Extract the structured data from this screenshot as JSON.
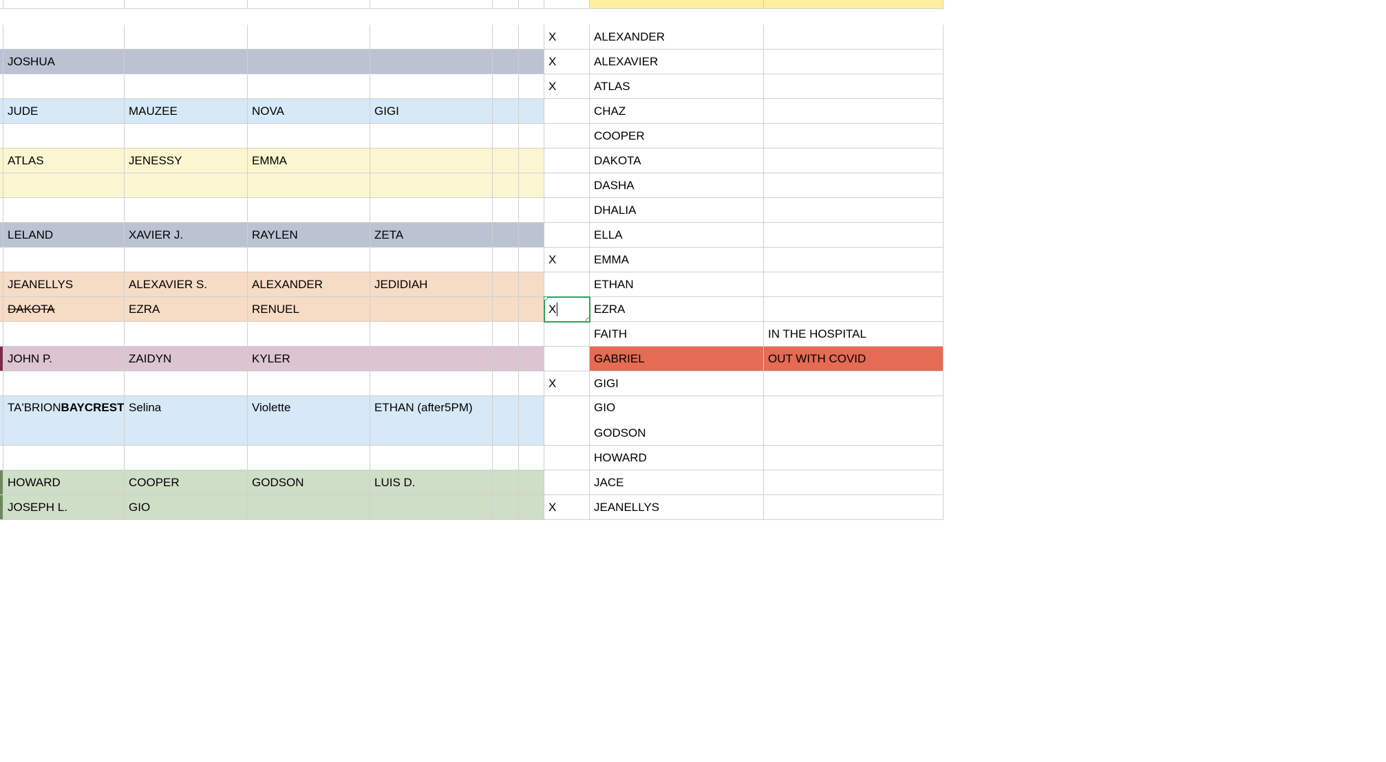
{
  "colors": {
    "yellow": "#ffef9e",
    "bluegray": "#bbc3d2",
    "ltblue": "#d7e8f6",
    "cream": "#fbf6d0",
    "peach": "#f6dbc5",
    "mauve": "#dcc4d1",
    "green": "#cfdec7",
    "red": "#e56b54"
  },
  "active_cell": {
    "row": 12,
    "col": "H",
    "value": "X"
  },
  "left_rows": [
    {
      "fill": null,
      "cells": [
        "",
        "",
        "",
        "",
        "",
        ""
      ]
    },
    {
      "fill": "bluegray",
      "cells": [
        "JOSHUA",
        "",
        "",
        "",
        "",
        ""
      ]
    },
    {
      "fill": null,
      "cells": [
        "",
        "",
        "",
        "",
        "",
        ""
      ]
    },
    {
      "fill": "ltblue",
      "cells": [
        "JUDE",
        "MAUZEE",
        "NOVA",
        "GIGI",
        "",
        ""
      ]
    },
    {
      "fill": null,
      "cells": [
        "",
        "",
        "",
        "",
        "",
        ""
      ]
    },
    {
      "fill": "cream",
      "cells": [
        "ATLAS",
        "JENESSY",
        "EMMA",
        "",
        "",
        ""
      ]
    },
    {
      "fill": "cream",
      "cells": [
        "",
        "",
        "",
        "",
        "",
        ""
      ]
    },
    {
      "fill": null,
      "cells": [
        "",
        "",
        "",
        "",
        "",
        ""
      ]
    },
    {
      "fill": "bluegray",
      "cells": [
        "LELAND",
        "XAVIER J.",
        "RAYLEN",
        "ZETA",
        "",
        ""
      ]
    },
    {
      "fill": null,
      "cells": [
        "",
        "",
        "",
        "",
        "",
        ""
      ]
    },
    {
      "fill": "peach",
      "cells": [
        "JEANELLYS",
        "ALEXAVIER S.",
        "ALEXANDER",
        "JEDIDIAH",
        "",
        ""
      ]
    },
    {
      "fill": "peach",
      "cells": [
        "DAKOTA",
        "EZRA",
        "RENUEL",
        "",
        "",
        ""
      ],
      "strike_first": true
    },
    {
      "fill": null,
      "cells": [
        "",
        "",
        "",
        "",
        "",
        ""
      ]
    },
    {
      "fill": "mauve",
      "cells": [
        "JOHN P.",
        "ZAIDYN",
        "KYLER",
        "",
        "",
        ""
      ],
      "left_edge": "mauve"
    },
    {
      "fill": null,
      "cells": [
        "",
        "",
        "",
        "",
        "",
        ""
      ]
    },
    {
      "fill": "ltblue",
      "two_line": true,
      "cells_lines": [
        [
          "TA'BRION",
          "BAYCREST"
        ],
        [
          "Selina"
        ],
        [
          "Violette"
        ],
        [
          "ETHAN (after",
          "5PM)"
        ],
        [
          ""
        ],
        [
          ""
        ]
      ]
    },
    {
      "fill": "ltblue",
      "cells": [
        "",
        "",
        "",
        "",
        "",
        ""
      ]
    },
    {
      "fill": null,
      "cells": [
        "",
        "",
        "",
        "",
        "",
        ""
      ]
    },
    {
      "fill": "green",
      "cells": [
        "HOWARD",
        "COOPER",
        "GODSON",
        "LUIS D.",
        "",
        ""
      ],
      "left_edge": "green"
    },
    {
      "fill": "green",
      "cells": [
        "JOSEPH L.",
        "GIO",
        "",
        "",
        "",
        ""
      ],
      "left_edge": "green"
    }
  ],
  "right_header_fill": "yellow",
  "right_rows": [
    {
      "H": "X",
      "I": "ALEXANDER",
      "J": ""
    },
    {
      "H": "X",
      "I": "ALEXAVIER",
      "J": ""
    },
    {
      "H": "X",
      "I": "ATLAS",
      "J": ""
    },
    {
      "H": "",
      "I": "CHAZ",
      "J": ""
    },
    {
      "H": "",
      "I": "COOPER",
      "J": ""
    },
    {
      "H": "",
      "I": "DAKOTA",
      "J": ""
    },
    {
      "H": "",
      "I": "DASHA",
      "J": ""
    },
    {
      "H": "",
      "I": "DHALIA",
      "J": ""
    },
    {
      "H": "",
      "I": "ELLA",
      "J": ""
    },
    {
      "H": "X",
      "I": "EMMA",
      "J": ""
    },
    {
      "H": "",
      "I": "ETHAN",
      "J": ""
    },
    {
      "H": "X",
      "I": "EZRA",
      "J": "",
      "active": true
    },
    {
      "H": "",
      "I": "FAITH",
      "J": "IN THE HOSPITAL"
    },
    {
      "H": "",
      "I": "GABRIEL",
      "J": "OUT WITH COVID",
      "row_fill": "red"
    },
    {
      "H": "X",
      "I": "GIGI",
      "J": ""
    },
    {
      "H": "",
      "I": "GIO",
      "J": ""
    },
    {
      "H": "",
      "I": "GODSON",
      "J": ""
    },
    {
      "H": "",
      "I": "HOWARD",
      "J": ""
    },
    {
      "H": "",
      "I": "JACE",
      "J": ""
    },
    {
      "H": "X",
      "I": "JEANELLYS",
      "J": ""
    }
  ]
}
